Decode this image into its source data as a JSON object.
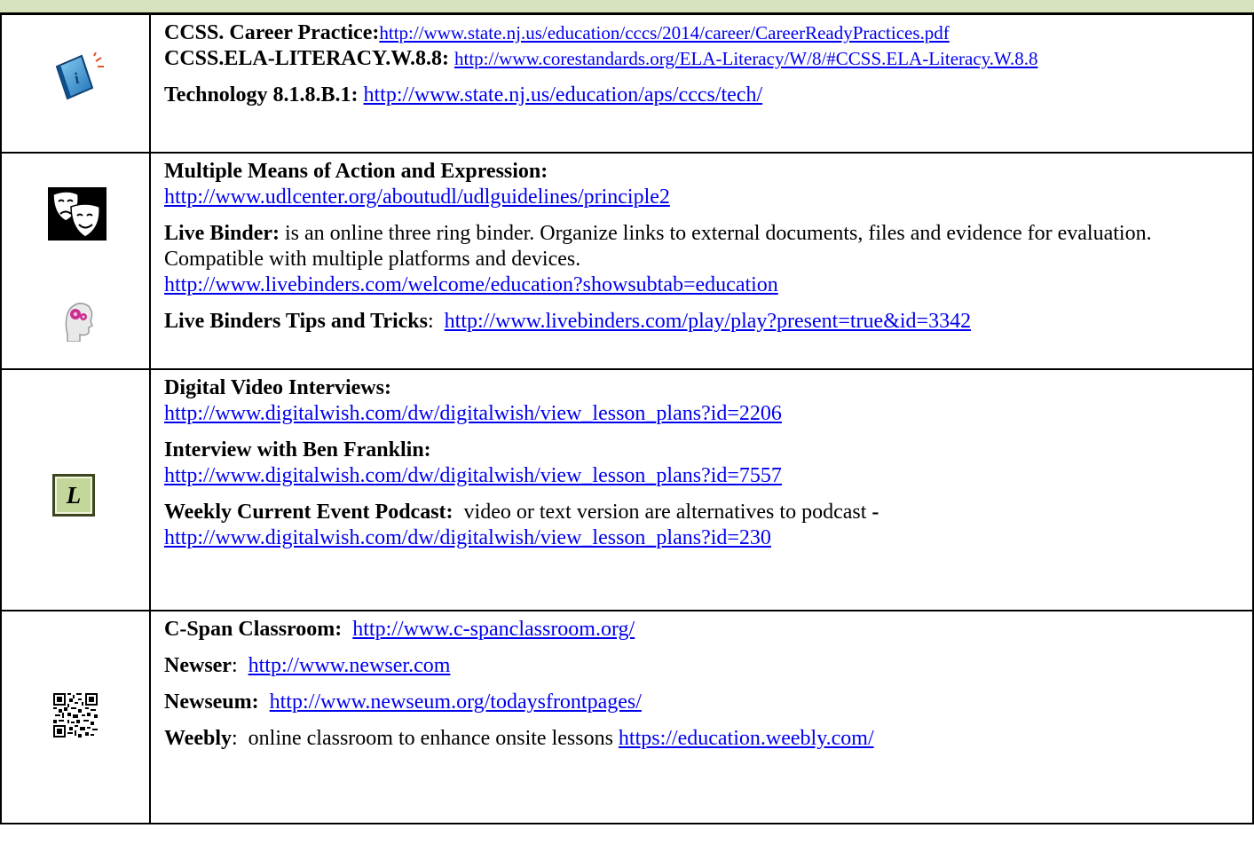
{
  "rows": [
    {
      "icon": "info-book-icon",
      "entries": [
        {
          "label": "CCSS. Career Practice:",
          "url": "http://www.state.nj.us/education/cccs/2014/career/CareerReadyPractices.pdf"
        },
        {
          "label": "CCSS.ELA-LITERACY.W.8.8:",
          "url": "http://www.corestandards.org/ELA-Literacy/W/8/#CCSS.ELA-Literacy.W.8.8"
        },
        {
          "label": "Technology 8.1.8.B.1:",
          "url": "http://www.state.nj.us/education/aps/cccs/tech/"
        }
      ]
    },
    {
      "icons": [
        "drama-masks-icon",
        "brain-gears-icon"
      ],
      "entries": [
        {
          "label": "Multiple Means of Action and Expression:",
          "url": "http://www.udlcenter.org/aboutudl/udlguidelines/principle2"
        },
        {
          "label": "Live Binder:",
          "desc": "  is an online three ring binder.  Organize links to external documents, files and evidence for evaluation.   Compatible with multiple platforms and devices.",
          "url": "http://www.livebinders.com/welcome/education?showsubtab=education"
        },
        {
          "label": "Live Binders Tips and Tricks",
          "sep": ":  ",
          "url": "http://www.livebinders.com/play/play?present=true&id=3342"
        }
      ]
    },
    {
      "icon": "l-badge-icon",
      "icon_letter": "L",
      "entries": [
        {
          "label": "Digital Video Interviews:",
          "url": "http://www.digitalwish.com/dw/digitalwish/view_lesson_plans?id=2206"
        },
        {
          "label": "Interview with Ben Franklin:",
          "url": "http://www.digitalwish.com/dw/digitalwish/view_lesson_plans?id=7557"
        },
        {
          "label": "Weekly Current Event Podcast:",
          "desc": "  video or text version are alternatives to podcast ",
          "dash": "-",
          "url": "http://www.digitalwish.com/dw/digitalwish/view_lesson_plans?id=230"
        }
      ]
    },
    {
      "icon": "qr-code-icon",
      "entries": [
        {
          "label": "C-Span Classroom:",
          "url": "http://www.c-spanclassroom.org/"
        },
        {
          "label": "Newser",
          "sep": ":  ",
          "url": "http://www.newser.com"
        },
        {
          "label": "Newseum:",
          "url": "http://www.newseum.org/todaysfrontpages/"
        },
        {
          "label": "Weebly",
          "desc": ":  online classroom to enhance onsite lessons ",
          "url": "https://education.weebly.com/"
        }
      ]
    }
  ],
  "colors": {
    "header": "#d6e3bc",
    "link": "#0000ee",
    "badge": "#c4d79b"
  }
}
